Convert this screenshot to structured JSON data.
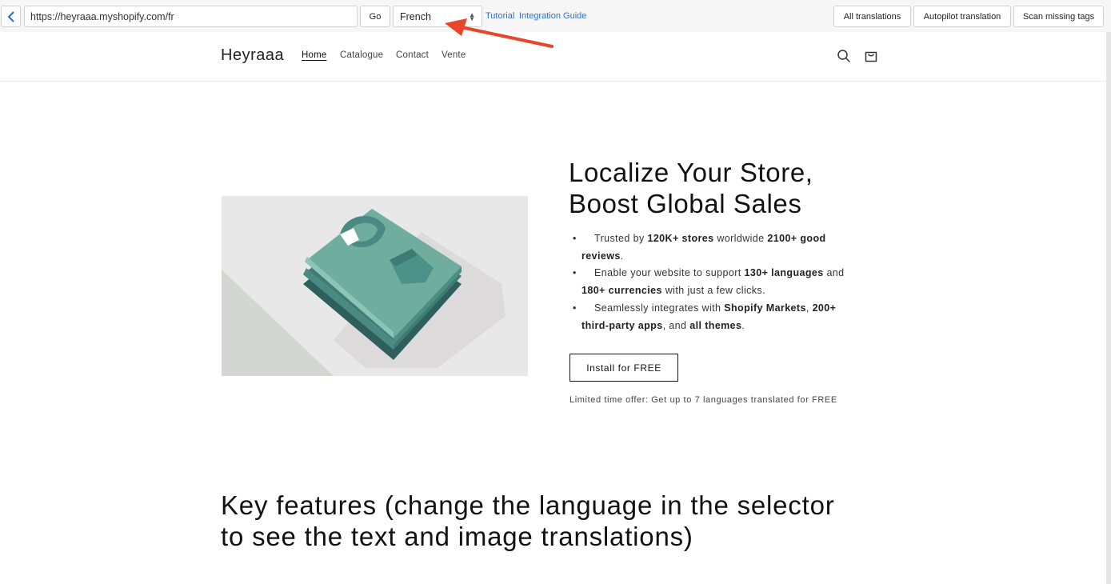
{
  "toolbar": {
    "url": "https://heyraaa.myshopify.com/fr",
    "go_label": "Go",
    "language": "French",
    "links": [
      "Tutorial",
      "Integration Guide"
    ],
    "buttons": [
      "All translations",
      "Autopilot translation",
      "Scan missing tags"
    ]
  },
  "store": {
    "logo": "Heyraaa",
    "nav": [
      "Home",
      "Catalogue",
      "Contact",
      "Vente"
    ],
    "active_nav": "Home",
    "icons": [
      "search-icon",
      "cart-icon"
    ]
  },
  "hero": {
    "title": "Localize Your Store, Boost Global Sales",
    "bullets": [
      [
        {
          "t": "Trusted by "
        },
        {
          "t": "120K+ stores",
          "b": true
        },
        {
          "t": " worldwide "
        },
        {
          "t": "2100+ good reviews",
          "b": true
        },
        {
          "t": "."
        }
      ],
      [
        {
          "t": "Enable your website to support "
        },
        {
          "t": "130+ languages",
          "b": true
        },
        {
          "t": " and "
        },
        {
          "t": "180+ currencies",
          "b": true
        },
        {
          "t": " with just a few clicks."
        }
      ],
      [
        {
          "t": "Seamlessly integrates with "
        },
        {
          "t": "Shopify Markets",
          "b": true
        },
        {
          "t": ", "
        },
        {
          "t": "200+ third-party apps",
          "b": true
        },
        {
          "t": ", and "
        },
        {
          "t": "all themes",
          "b": true
        },
        {
          "t": "."
        }
      ]
    ],
    "cta": "Install for FREE",
    "offer": "Limited time offer: Get up to 7 languages translated for FREE"
  },
  "features": {
    "title": "Key features (change the language in the selector to see the text and image translations)"
  },
  "colors": {
    "link": "#2c6ecb",
    "annotation_arrow": "#e8452c",
    "shirt_top": "#6fae9f",
    "shirt_dark": "#3a706e"
  }
}
